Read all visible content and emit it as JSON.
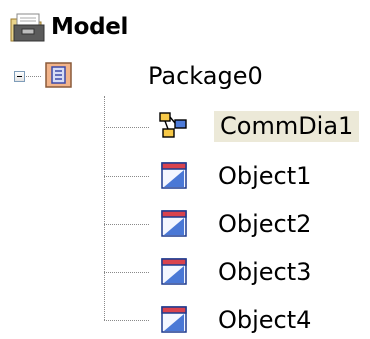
{
  "tree": {
    "root": {
      "label": "Model",
      "icon": "model-folder-icon"
    },
    "package": {
      "label": "Package0",
      "icon": "package-icon",
      "expanded": true
    },
    "children": [
      {
        "label": "CommDia1",
        "icon": "communication-diagram-icon",
        "selected": true
      },
      {
        "label": "Object1",
        "icon": "object-icon"
      },
      {
        "label": "Object2",
        "icon": "object-icon"
      },
      {
        "label": "Object3",
        "icon": "object-icon"
      },
      {
        "label": "Object4",
        "icon": "object-icon"
      }
    ]
  },
  "colors": {
    "selection_bg": "#ece9d8",
    "object_icon_header": "#d9434e",
    "package_icon": "#f2b48a",
    "diagram_icon": "#f7c948"
  }
}
